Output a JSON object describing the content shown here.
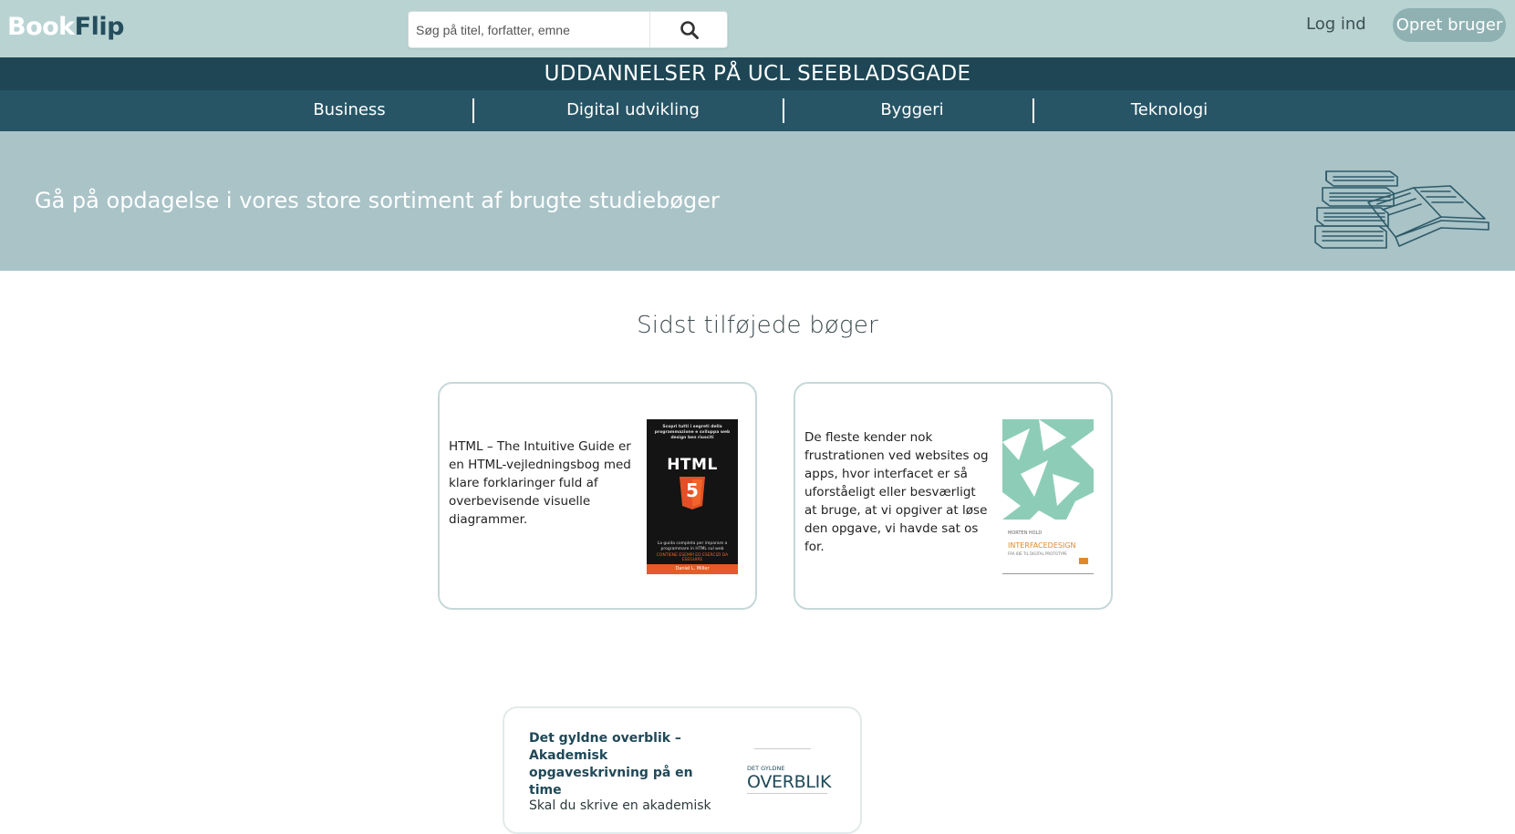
{
  "header": {
    "logo_part1": "Book",
    "logo_part2": "Flip",
    "search_placeholder": "Søg på titel, forfatter, emne",
    "login_label": "Log ind",
    "signup_label": "Opret bruger"
  },
  "title_bar": "UDDANNELSER PÅ UCL SEEBLADSGADE",
  "nav": {
    "items": [
      "Business",
      "Digital udvikling",
      "Byggeri",
      "Teknologi"
    ]
  },
  "hero": {
    "tagline": "Gå på opdagelse i vores store sortiment af brugte studiebøger"
  },
  "recent": {
    "heading": "Sidst tilføjede bøger",
    "cards": [
      {
        "description": "HTML – The Intuitive Guide er en HTML-vejledningsbog med klare forklaringer fuld af overbevisende visuelle diagrammer.",
        "cover": {
          "top_text": "Scopri tutti i segreti della programmazione e sviluppa web design ben riusciti",
          "title": "HTML",
          "badge": "5",
          "bottom_text": "La guida completa per imparare a programmare in HTML sul web",
          "tagline": "CONTIENE ESEMPI ED ESERCIZI DA ESEGUIRE",
          "author": "Daniel L. Miller"
        }
      },
      {
        "description": "De fleste kender nok frustrationen ved websites og apps, hvor interfacet er så uforståeligt eller besværligt at bruge, at vi opgiver at løse den opgave, vi havde sat os for.",
        "cover": {
          "author": "MORTEN HOLD",
          "title": "INTERFACEDESIGN",
          "subtitle": "FRA IDÉ TIL DIGITAL PROTOTYPE"
        }
      },
      {
        "title": "Det gyldne overblik – Akademisk opgaveskrivning på en time",
        "description": "Skal du skrive en akademisk",
        "cover": {
          "small_line": "DET GYLDNE",
          "big_line": "OVERBLIK"
        }
      }
    ]
  },
  "colors": {
    "topbar": "#b9d3d3",
    "title_bar": "#1e4654",
    "nav_bar": "#275566",
    "hero": "#a9c3c7",
    "accent_dark": "#254e5c",
    "signup_button": "#8fb1b2"
  }
}
